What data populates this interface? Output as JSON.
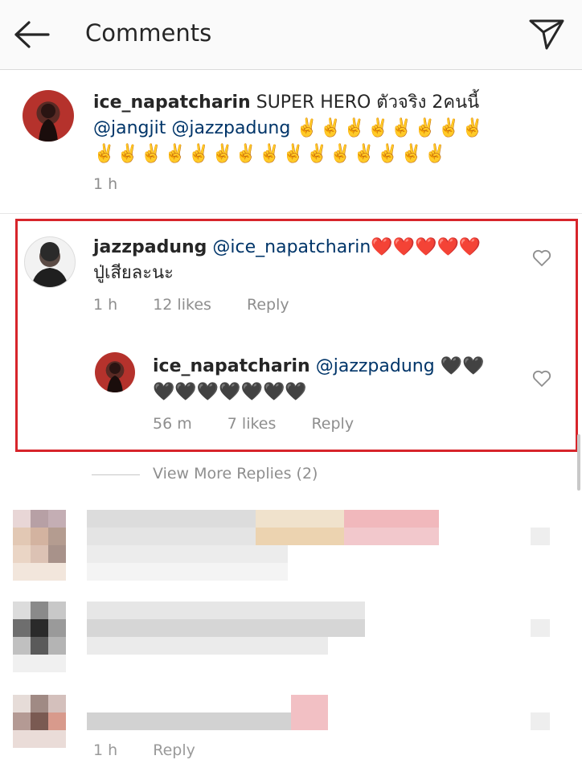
{
  "header": {
    "title": "Comments",
    "back_icon": "arrow-left-icon",
    "send_icon": "paper-plane-icon"
  },
  "comment1": {
    "username": "ice_napatcharin",
    "text": "SUPER HERO ตัวจริง 2คนนี้",
    "mention1": "@jangjit",
    "mention2": "@jazzpadung",
    "emoji_line1": "✌️✌️✌️✌️✌️✌️✌️✌️",
    "emoji_line2": "✌️✌️✌️✌️✌️✌️✌️✌️✌️✌️✌️✌️✌️✌️✌️",
    "time": "1 h"
  },
  "comment2": {
    "username": "jazzpadung",
    "mention": "@ice_napatcharin",
    "hearts": "❤️❤️❤️❤️❤️",
    "text_line2": "ปู่เสียละนะ",
    "time": "1 h",
    "likes": "12 likes",
    "reply": "Reply"
  },
  "reply1": {
    "username": "ice_napatcharin",
    "mention": "@jazzpadung",
    "hearts1": "🖤🖤",
    "hearts2": "🖤🖤🖤🖤🖤🖤🖤",
    "time": "56 m",
    "likes": "7 likes",
    "reply": "Reply"
  },
  "view_more": "View More Replies (2)",
  "obscured_row_partial": {
    "time": "1 h",
    "reply": "Reply"
  },
  "colors": {
    "mention": "#003569",
    "muted": "#8e8e8e",
    "highlight_box": "#d7252b"
  }
}
